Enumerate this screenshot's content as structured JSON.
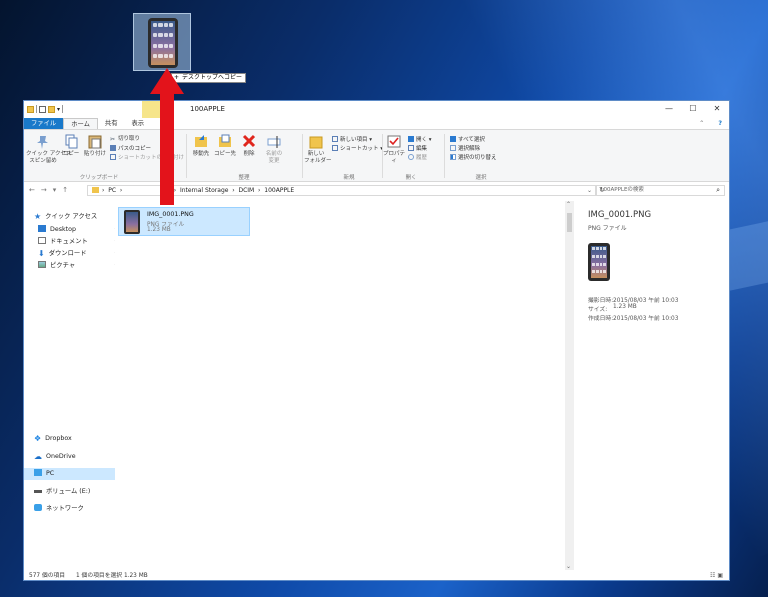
{
  "drag": {
    "tooltip": "デスクトップへコピー"
  },
  "window": {
    "title": "100APPLE",
    "controls": [
      "—",
      "☐",
      "✕"
    ]
  },
  "tabs": [
    "ファイル",
    "ホーム",
    "共有",
    "表示"
  ],
  "ribbon": {
    "clipboard": {
      "pin": "クイック アクセス\nスピン留め",
      "copy": "コピー",
      "paste": "貼り付け",
      "cut": "切り取り",
      "copy_path": "パスのコピー",
      "paste_shortcut": "ショートカットの貼り付け",
      "label": "クリップボード"
    },
    "organize": {
      "move": "移動先",
      "copyto": "コピー先",
      "delete": "削除",
      "rename": "名前の\n変更",
      "label": "整理"
    },
    "new": {
      "new_folder": "新しい\nフォルダー",
      "new_item": "新しい項目 ▾",
      "shortcut": "ショートカット ▾",
      "label": "新規"
    },
    "open": {
      "properties": "プロパティ",
      "open": "開く ▾",
      "edit": "編集",
      "history": "履歴",
      "label": "開く"
    },
    "select": {
      "select_all": "すべて選択",
      "select_none": "選択解除",
      "invert": "選択の切り替え",
      "label": "選択"
    }
  },
  "address": {
    "nav": [
      "←",
      "→",
      "▾",
      "↑"
    ],
    "path": "›  PC  ›                           ›  Internal Storage  ›  DCIM  ›  100APPLE",
    "search_placeholder": "100APPLEの検索"
  },
  "nav": {
    "quick_access": "クイック アクセス",
    "items": [
      "Desktop",
      "ドキュメント",
      "ダウンロード",
      "ピクチャ"
    ],
    "dropbox": "Dropbox",
    "onedrive": "OneDrive",
    "pc": "PC",
    "volume": "ボリューム (E:)",
    "network": "ネットワーク"
  },
  "file": {
    "name": "IMG_0001.PNG",
    "type": "PNG ファイル",
    "size": "1.23 MB"
  },
  "preview": {
    "name": "IMG_0001.PNG",
    "type": "PNG ファイル",
    "rows": [
      {
        "k": "撮影日時:",
        "v": "2015/08/03 午前 10:03"
      },
      {
        "k": "サイズ:",
        "v": "1.23 MB"
      },
      {
        "k": "作成日時:",
        "v": "2015/08/03 午前 10:03"
      }
    ]
  },
  "status": {
    "count": "577 個の項目",
    "selected": "1 個の項目を選択 1.23 MB"
  },
  "colors": {
    "accent": "#1979ca",
    "selection": "#cce8ff",
    "arrow": "#e3131b"
  }
}
